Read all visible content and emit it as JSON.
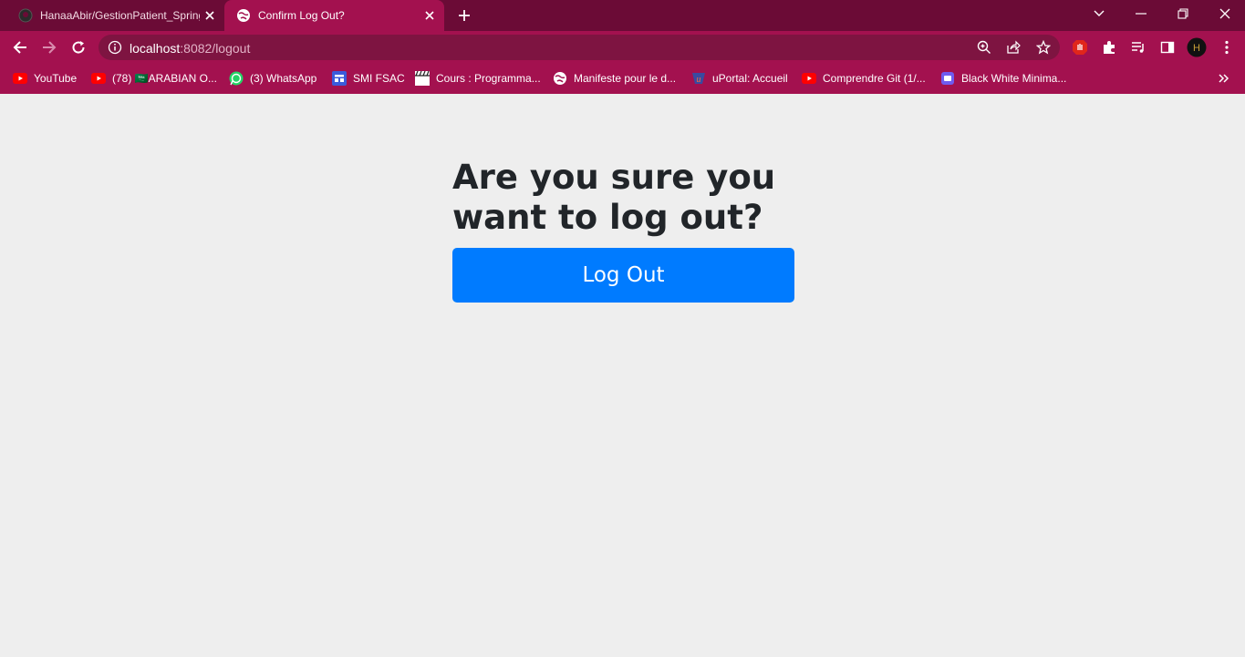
{
  "browser": {
    "tabs": [
      {
        "title": "HanaaAbir/GestionPatient_Spring",
        "icon": "github-icon",
        "active": false
      },
      {
        "title": "Confirm Log Out?",
        "icon": "globe-icon",
        "active": true
      }
    ],
    "address": {
      "host": "localhost",
      "rest": ":8082/logout"
    },
    "bookmarks": [
      {
        "label": "YouTube",
        "icon": "youtube-icon"
      },
      {
        "label": "(78) 🇸🇦ARABIAN O...",
        "icon": "youtube-icon"
      },
      {
        "label": "(3) WhatsApp",
        "icon": "whatsapp-icon"
      },
      {
        "label": "SMI FSAC",
        "icon": "site-icon"
      },
      {
        "label": "Cours : Programma...",
        "icon": "clapper-icon"
      },
      {
        "label": "Manifeste pour le d...",
        "icon": "globe-icon"
      },
      {
        "label": "uPortal: Accueil",
        "icon": "uportal-icon"
      },
      {
        "label": "Comprendre Git (1/...",
        "icon": "youtube-icon"
      },
      {
        "label": "Black White Minima...",
        "icon": "canva-icon"
      }
    ],
    "profile_initial": "H",
    "colors": {
      "tabstrip": "#6b0b36",
      "toolbar": "#a3114f",
      "omnibox": "#7e1441"
    }
  },
  "page": {
    "heading": "Are you sure you want to log out?",
    "button_label": "Log Out",
    "colors": {
      "background": "#eeeeee",
      "button": "#007bff",
      "text": "#212529"
    }
  }
}
